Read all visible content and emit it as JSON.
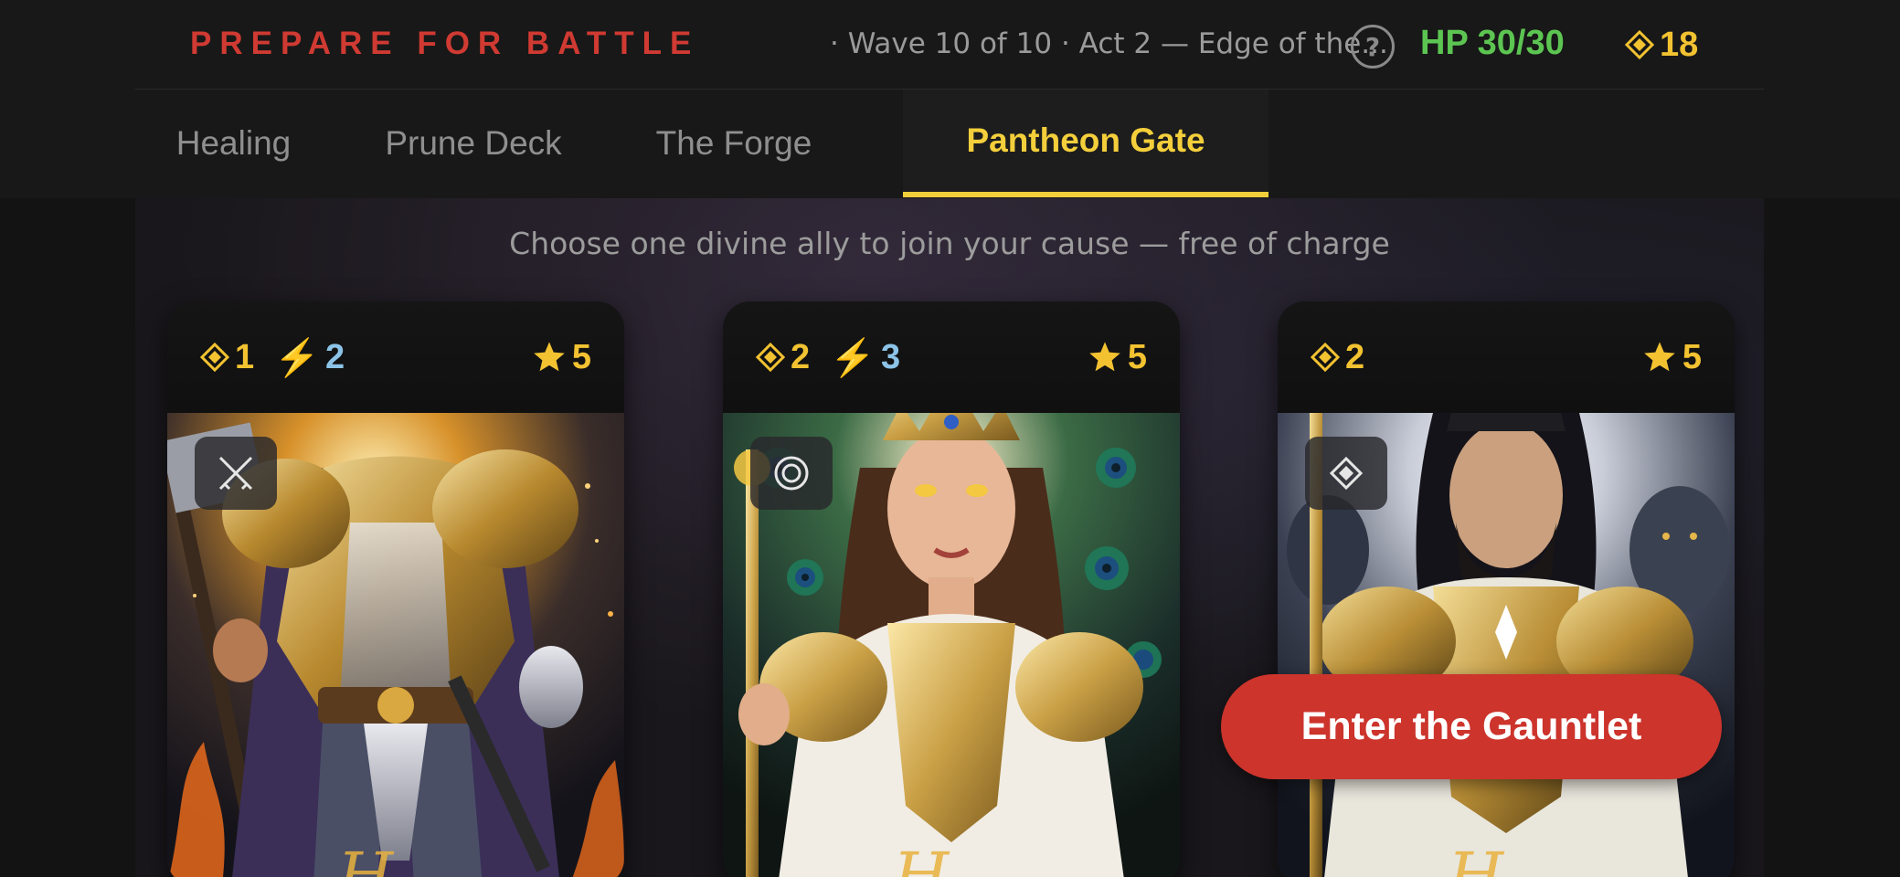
{
  "header": {
    "title": "PREPARE FOR BATTLE",
    "subtitle": "· Wave 10 of 10 · Act 2 — Edge of the...",
    "help_label": "?",
    "hp": "HP 30/30",
    "gold": "18"
  },
  "tabs": [
    {
      "label": "Healing",
      "active": false
    },
    {
      "label": "Prune Deck",
      "active": false
    },
    {
      "label": "The Forge",
      "active": false
    },
    {
      "label": "Pantheon Gate",
      "active": true
    }
  ],
  "instruction": "Choose one divine ally to join your cause — free of charge",
  "cards": [
    {
      "cost": "1",
      "energy": "2",
      "rarity": "5",
      "type_icon": "crossed-swords-icon",
      "name": "H..."
    },
    {
      "cost": "2",
      "energy": "3",
      "rarity": "5",
      "type_icon": "target-icon",
      "name": "H..."
    },
    {
      "cost": "2",
      "energy": "",
      "rarity": "5",
      "type_icon": "diamond-icon",
      "name": "H..."
    }
  ],
  "cta_label": "Enter the Gauntlet",
  "colors": {
    "title_red": "#cf3a32",
    "hp_green": "#5cc552",
    "gold": "#f2c231",
    "tab_active": "#f4cf3b",
    "energy_blue": "#8cc4e8",
    "cta_red": "#cc342c"
  }
}
